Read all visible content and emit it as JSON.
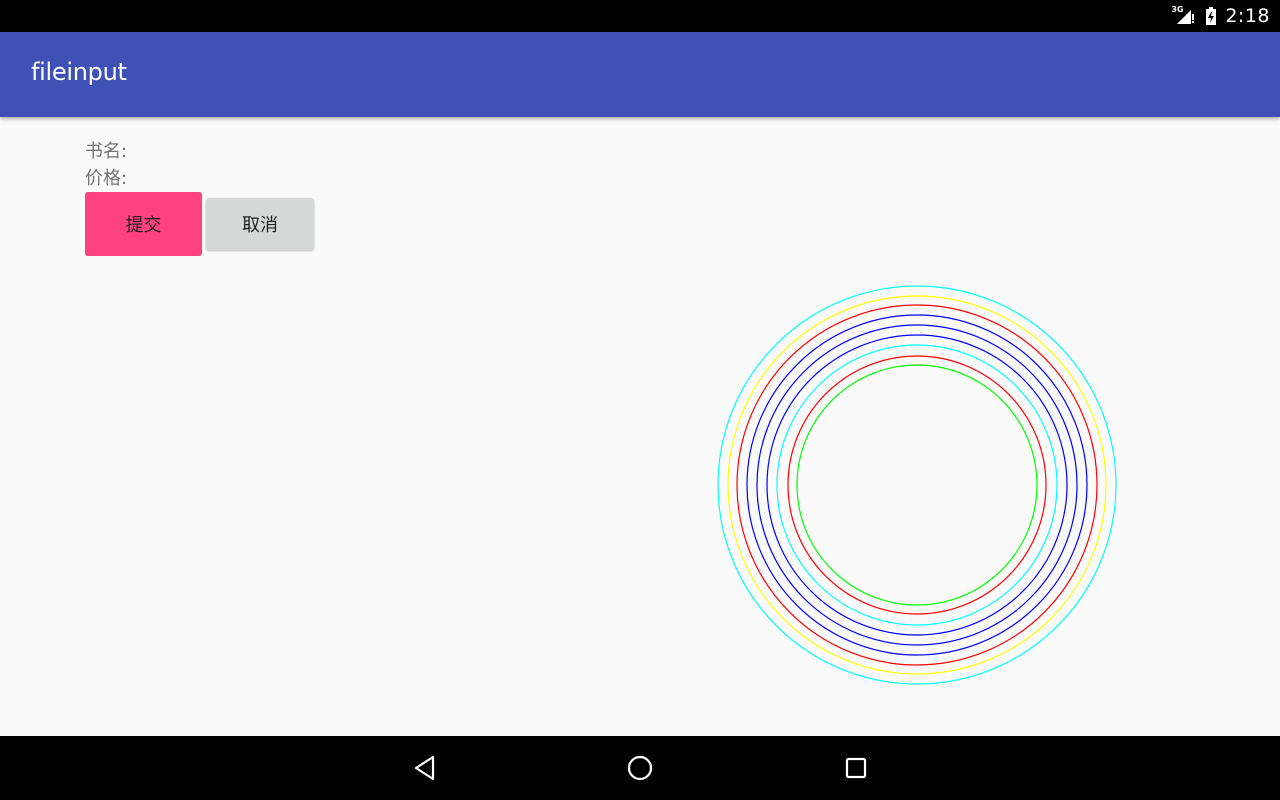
{
  "status_bar": {
    "network_type": "3G",
    "time": "2:18",
    "icons": [
      "signal-icon",
      "battery-icon"
    ]
  },
  "app_bar": {
    "title": "fileinput",
    "color": "#3f51b5"
  },
  "form": {
    "book_name_label": "书名:",
    "price_label": "价格:",
    "submit_label": "提交",
    "cancel_label": "取消",
    "submit_color": "#ff4081",
    "cancel_color": "#d6d7d7"
  },
  "circles": {
    "colors_outer_to_inner": [
      "#00ffff",
      "#ffff00",
      "#ff0000",
      "#0000ff",
      "#0000ff",
      "#0000ff",
      "#00ffff",
      "#ff0000",
      "#00ff00"
    ]
  },
  "nav_bar": {
    "icons": [
      "back-icon",
      "home-icon",
      "recents-icon"
    ]
  }
}
